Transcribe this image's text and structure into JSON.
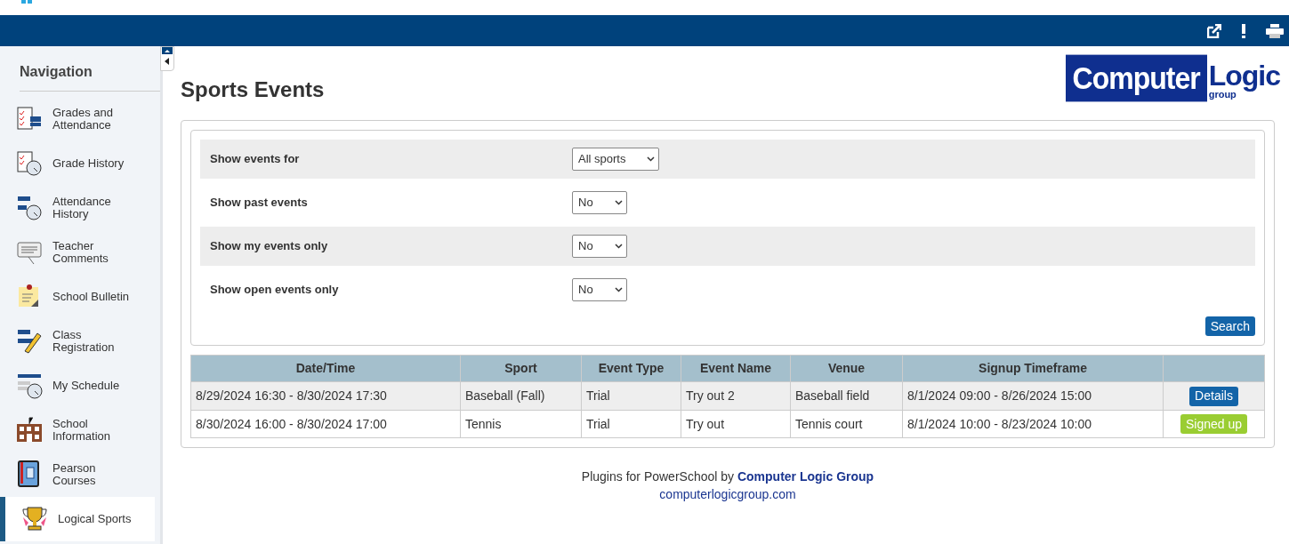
{
  "navigation": {
    "title": "Navigation",
    "items": [
      {
        "label": "Grades and Attendance",
        "selected": false
      },
      {
        "label": "Grade History",
        "selected": false
      },
      {
        "label": "Attendance History",
        "selected": false
      },
      {
        "label": "Teacher Comments",
        "selected": false
      },
      {
        "label": "School Bulletin",
        "selected": false
      },
      {
        "label": "Class Registration",
        "selected": false
      },
      {
        "label": "My Schedule",
        "selected": false
      },
      {
        "label": "School Information",
        "selected": false
      },
      {
        "label": "Pearson Courses",
        "selected": false
      },
      {
        "label": "Logical Sports",
        "selected": true
      }
    ]
  },
  "page": {
    "title": "Sports Events",
    "logo": {
      "word_1": "Computer",
      "word_2": "Logic",
      "word_3": "group"
    }
  },
  "filters": [
    {
      "label": "Show events for",
      "value": "All sports"
    },
    {
      "label": "Show past events",
      "value": "No"
    },
    {
      "label": "Show my events only",
      "value": "No"
    },
    {
      "label": "Show open events only",
      "value": "No"
    }
  ],
  "search_button": "Search",
  "table": {
    "columns": [
      "Date/Time",
      "Sport",
      "Event Type",
      "Event Name",
      "Venue",
      "Signup Timeframe",
      ""
    ],
    "rows": [
      {
        "cells": [
          "8/29/2024 16:30 - 8/30/2024 17:30",
          "Baseball (Fall)",
          "Trial",
          "Try out 2",
          "Baseball field",
          "8/1/2024 09:00 - 8/26/2024 15:00"
        ],
        "action": {
          "kind": "details",
          "label": "Details"
        }
      },
      {
        "cells": [
          "8/30/2024 16:00 - 8/30/2024 17:00",
          "Tennis",
          "Trial",
          "Try out",
          "Tennis court",
          "8/1/2024 10:00 - 8/23/2024 10:00"
        ],
        "action": {
          "kind": "signed_up",
          "label": "Signed up"
        }
      }
    ]
  },
  "footer": {
    "text": "Plugins for PowerSchool by",
    "link": "Computer Logic Group",
    "url": "computerlogicgroup.com"
  }
}
